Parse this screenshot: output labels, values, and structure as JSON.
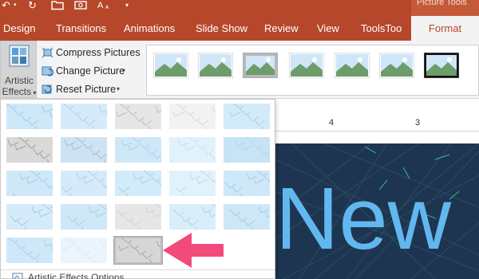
{
  "quick_access": {
    "undo_icon": "undo-icon",
    "redo_icon": "refresh-icon",
    "open_icon": "folder-icon",
    "icon_icon": "camera-icon",
    "font_icon": "font-size-icon"
  },
  "contextual_tab_group": "Picture Tools",
  "tabs": [
    {
      "label": "Design"
    },
    {
      "label": "Transitions"
    },
    {
      "label": "Animations"
    },
    {
      "label": "Slide Show"
    },
    {
      "label": "Review"
    },
    {
      "label": "View"
    },
    {
      "label": "ToolsToo"
    },
    {
      "label": "Format",
      "active": true
    }
  ],
  "ribbon": {
    "artistic_effects": {
      "line1": "Artistic",
      "line2": "Effects"
    },
    "compress": "Compress Pictures",
    "change": "Change Picture",
    "reset": "Reset Picture",
    "picture_styles_count": 7
  },
  "ruler": {
    "labels": [
      "4",
      "3"
    ]
  },
  "slide": {
    "title": "New"
  },
  "artistic_effects_menu": {
    "grid": {
      "rows": 5,
      "cols": 5,
      "items": 23
    },
    "selected_item": 23,
    "options_label": "Artistic Effects Options..."
  },
  "colors": {
    "accent": "#b7472a",
    "slide_bg": "#1d3550",
    "slide_text": "#61b8ef",
    "arrow": "#f24a7a"
  }
}
